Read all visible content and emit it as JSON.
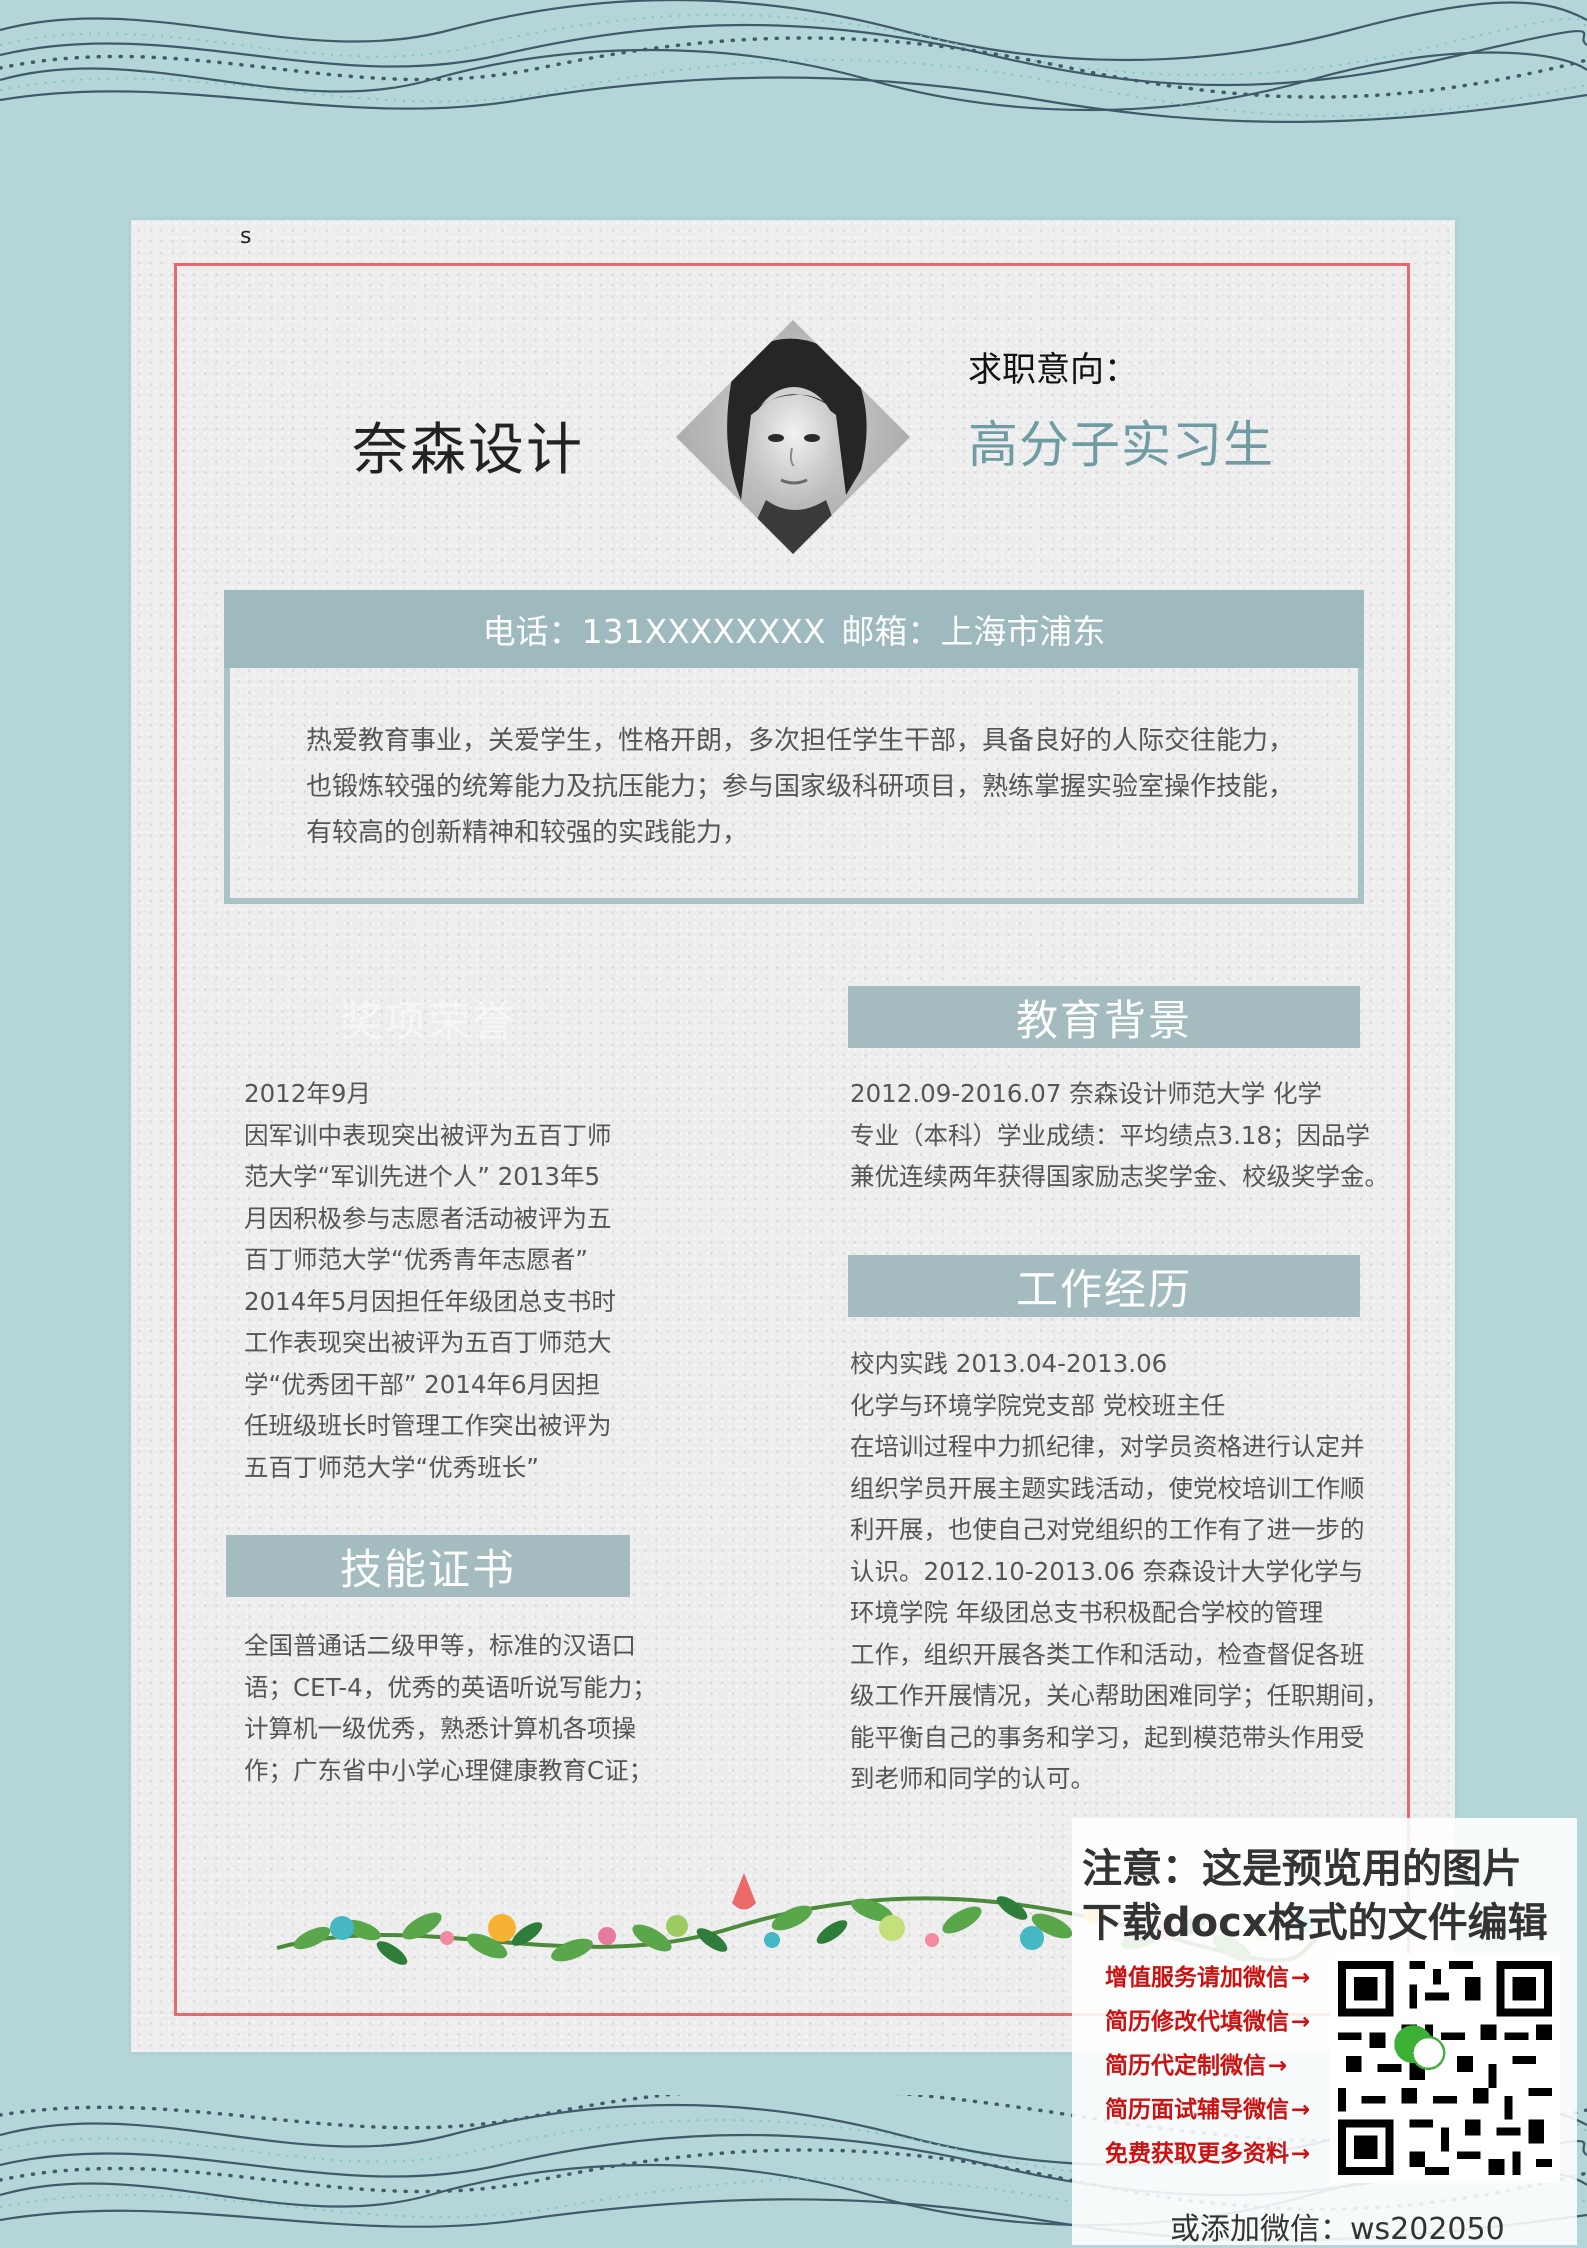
{
  "corner_mark": "s",
  "header": {
    "name": "奈森设计",
    "intent_label": "求职意向：",
    "intent_value": "高分子实习生"
  },
  "contact": {
    "phone_label": "电话：131XXXXXXXX",
    "email_label": "邮箱：上海市浦东"
  },
  "summary": {
    "lines": [
      "热爱教育事业，关爱学生，性格开朗，多次担任学生干部，具备良好的人际交往能力，",
      "也锻炼较强的统筹能力及抗压能力；参与国家级科研项目，熟练掌握实验室操作技能，",
      "有较高的创新精神和较强的实践能力，"
    ]
  },
  "awards": {
    "title": "奖项荣誉",
    "lines": [
      "2012年9月",
      "因军训中表现突出被评为五百丁师",
      "范大学“军训先进个人” 2013年5",
      "月因积极参与志愿者活动被评为五",
      "百丁师范大学“优秀青年志愿者”",
      "2014年5月因担任年级团总支书时",
      "工作表现突出被评为五百丁师范大",
      "学“优秀团干部” 2014年6月因担",
      "任班级班长时管理工作突出被评为",
      "五百丁师范大学“优秀班长”"
    ]
  },
  "skills": {
    "title": "技能证书",
    "lines": [
      "全国普通话二级甲等，标准的汉语口",
      "语；CET-4，优秀的英语听说写能力；",
      "计算机一级优秀，熟悉计算机各项操",
      "作；广东省中小学心理健康教育C证；"
    ]
  },
  "education": {
    "title": "教育背景",
    "lines": [
      "2012.09-2016.07 奈森设计师范大学 化学",
      "专业（本科）学业成绩：平均绩点3.18；因品学",
      "兼优连续两年获得国家励志奖学金、校级奖学金。"
    ]
  },
  "work": {
    "title": "工作经历",
    "lines": [
      "校内实践 2013.04-2013.06",
      "化学与环境学院党支部 党校班主任",
      "在培训过程中力抓纪律，对学员资格进行认定并",
      "组织学员开展主题实践活动，使党校培训工作顺",
      "利开展，也使自己对党组织的工作有了进一步的",
      "认识。2012.10-2013.06 奈森设计大学化学与",
      "环境学院 年级团总支书积极配合学校的管理",
      "工作，组织开展各类工作和活动，检查督促各班",
      "级工作开展情况，关心帮助困难同学；任职期间，",
      "能平衡自己的事务和学习，起到模范带头作用受",
      "到老师和同学的认可。"
    ]
  },
  "notice": {
    "line1": "注意：这是预览用的图片",
    "line2": "下载docx格式的文件编辑",
    "services": [
      "增值服务请加微信",
      "简历修改代填微信",
      "简历代定制微信",
      "简历面试辅导微信",
      "免费获取更多资料"
    ],
    "arrow": "→",
    "wechat": "或添加微信：ws202050"
  },
  "colors": {
    "background": "#b4d6d8",
    "paper": "#ededee",
    "frame": "#e36b6b",
    "section_fill": "#a4bcbf",
    "intent_value": "#6f9ba2",
    "service_text": "#cc1111"
  },
  "icons": {
    "photo": "portrait-photo",
    "qr": "qr-code",
    "vine": "floral-vine",
    "waves": "wave-pattern"
  }
}
